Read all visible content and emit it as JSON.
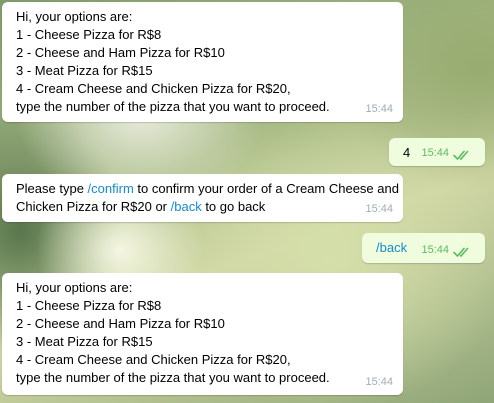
{
  "messages": [
    {
      "lines": [
        "Hi, your options are:",
        " 1 - Cheese Pizza for R$8",
        " 2 - Cheese and Ham Pizza for R$10",
        " 3 - Meat Pizza for R$15",
        " 4 - Cream Cheese and Chicken Pizza for R$20,",
        " type the number of the pizza that you want to proceed."
      ],
      "time": "15:44"
    },
    {
      "text": "4",
      "time": "15:44"
    },
    {
      "line1": {
        "pre": "Please type ",
        "link": "/confirm",
        "post": " to confirm your order of a Cream Cheese and"
      },
      "line2": {
        "pre": "Chicken Pizza for R$20 or ",
        "link": "/back",
        "post": " to go back"
      },
      "time": "15:44"
    },
    {
      "text": "/back",
      "time": "15:44"
    },
    {
      "lines": [
        "Hi, your options are:",
        " 1 - Cheese Pizza for R$8",
        " 2 - Cheese and Ham Pizza for R$10",
        " 3 - Meat Pizza for R$15",
        " 4 - Cream Cheese and Chicken Pizza for R$20,",
        " type the number of the pizza that you want to proceed."
      ],
      "time": "15:44"
    }
  ],
  "colors": {
    "incoming_bubble": "#ffffff",
    "outgoing_bubble": "#effdde",
    "link": "#168acd",
    "read_checks": "#5dbb60",
    "time_incoming": "#a0acb6"
  },
  "icons": {
    "read_status": "double-check-icon"
  }
}
